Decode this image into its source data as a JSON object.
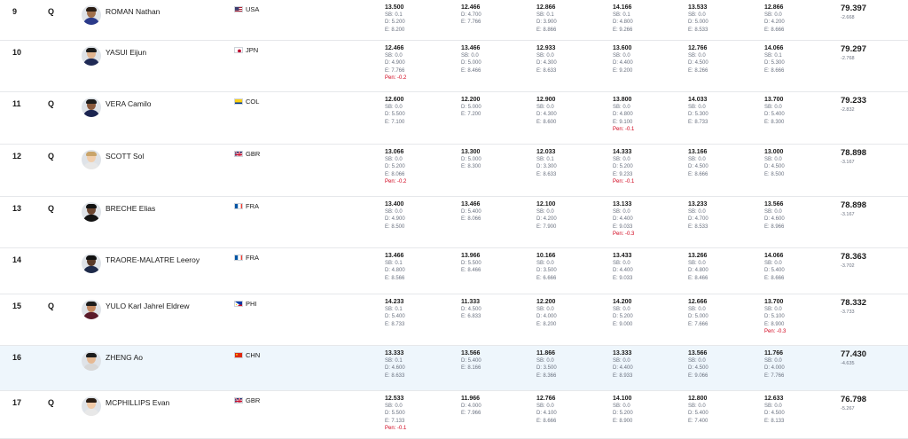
{
  "colors": {
    "highlight_bg": "#eef6fc",
    "penalty": "#d0021b",
    "divider": "#e6e8eb"
  },
  "rows": [
    {
      "rank": "9",
      "q": "Q",
      "name": "ROMAN Nathan",
      "country": "USA",
      "flag": "usa",
      "apps": [
        {
          "score": "13.500",
          "sb": "SB: 0.1",
          "d": "D: 5.200",
          "e": "E: 8.200",
          "pen": ""
        },
        {
          "score": "12.466",
          "sb": "D: 4.700",
          "d": "E: 7.766",
          "e": "",
          "pen": ""
        },
        {
          "score": "12.866",
          "sb": "SB: 0.1",
          "d": "D: 3.900",
          "e": "E: 8.866",
          "pen": ""
        },
        {
          "score": "14.166",
          "sb": "SB: 0.1",
          "d": "D: 4.800",
          "e": "E: 9.266",
          "pen": ""
        },
        {
          "score": "13.533",
          "sb": "SB: 0.0",
          "d": "D: 5.000",
          "e": "E: 8.533",
          "pen": ""
        },
        {
          "score": "12.866",
          "sb": "SB: 0.0",
          "d": "D: 4.200",
          "e": "E: 8.666",
          "pen": ""
        }
      ],
      "total": "79.397",
      "gap": "-2.668"
    },
    {
      "rank": "10",
      "q": "",
      "name": "YASUI Eijun",
      "country": "JPN",
      "flag": "jpn",
      "apps": [
        {
          "score": "12.466",
          "sb": "SB: 0.0",
          "d": "D: 4.900",
          "e": "E: 7.766",
          "pen": "Pen: -0.2"
        },
        {
          "score": "13.466",
          "sb": "SB: 0.0",
          "d": "D: 5.000",
          "e": "E: 8.466",
          "pen": ""
        },
        {
          "score": "12.933",
          "sb": "SB: 0.0",
          "d": "D: 4.300",
          "e": "E: 8.633",
          "pen": ""
        },
        {
          "score": "13.600",
          "sb": "SB: 0.0",
          "d": "D: 4.400",
          "e": "E: 9.200",
          "pen": ""
        },
        {
          "score": "12.766",
          "sb": "SB: 0.0",
          "d": "D: 4.500",
          "e": "E: 8.266",
          "pen": ""
        },
        {
          "score": "14.066",
          "sb": "SB: 0.1",
          "d": "D: 5.300",
          "e": "E: 8.666",
          "pen": ""
        }
      ],
      "total": "79.297",
      "gap": "-2.768"
    },
    {
      "rank": "11",
      "q": "Q",
      "name": "VERA Camilo",
      "country": "COL",
      "flag": "col",
      "apps": [
        {
          "score": "12.600",
          "sb": "SB: 0.0",
          "d": "D: 5.500",
          "e": "E: 7.100",
          "pen": ""
        },
        {
          "score": "12.200",
          "sb": "D: 5.000",
          "d": "E: 7.200",
          "e": "",
          "pen": ""
        },
        {
          "score": "12.900",
          "sb": "SB: 0.0",
          "d": "D: 4.300",
          "e": "E: 8.600",
          "pen": ""
        },
        {
          "score": "13.800",
          "sb": "SB: 0.0",
          "d": "D: 4.800",
          "e": "E: 9.100",
          "pen": "Pen: -0.1"
        },
        {
          "score": "14.033",
          "sb": "SB: 0.0",
          "d": "D: 5.300",
          "e": "E: 8.733",
          "pen": ""
        },
        {
          "score": "13.700",
          "sb": "SB: 0.0",
          "d": "D: 5.400",
          "e": "E: 8.300",
          "pen": ""
        }
      ],
      "total": "79.233",
      "gap": "-2.832"
    },
    {
      "rank": "12",
      "q": "Q",
      "name": "SCOTT Sol",
      "country": "GBR",
      "flag": "gbr",
      "apps": [
        {
          "score": "13.066",
          "sb": "SB: 0.0",
          "d": "D: 5.200",
          "e": "E: 8.066",
          "pen": "Pen: -0.2"
        },
        {
          "score": "13.300",
          "sb": "D: 5.000",
          "d": "E: 8.300",
          "e": "",
          "pen": ""
        },
        {
          "score": "12.033",
          "sb": "SB: 0.1",
          "d": "D: 3.300",
          "e": "E: 8.633",
          "pen": ""
        },
        {
          "score": "14.333",
          "sb": "SB: 0.0",
          "d": "D: 5.200",
          "e": "E: 9.233",
          "pen": "Pen: -0.1"
        },
        {
          "score": "13.166",
          "sb": "SB: 0.0",
          "d": "D: 4.500",
          "e": "E: 8.666",
          "pen": ""
        },
        {
          "score": "13.000",
          "sb": "SB: 0.0",
          "d": "D: 4.500",
          "e": "E: 8.500",
          "pen": ""
        }
      ],
      "total": "78.898",
      "gap": "-3.167"
    },
    {
      "rank": "13",
      "q": "Q",
      "name": "BRECHE Elias",
      "country": "FRA",
      "flag": "fra",
      "apps": [
        {
          "score": "13.400",
          "sb": "SB: 0.0",
          "d": "D: 4.900",
          "e": "E: 8.500",
          "pen": ""
        },
        {
          "score": "13.466",
          "sb": "D: 5.400",
          "d": "E: 8.066",
          "e": "",
          "pen": ""
        },
        {
          "score": "12.100",
          "sb": "SB: 0.0",
          "d": "D: 4.200",
          "e": "E: 7.900",
          "pen": ""
        },
        {
          "score": "13.133",
          "sb": "SB: 0.0",
          "d": "D: 4.400",
          "e": "E: 9.033",
          "pen": "Pen: -0.3"
        },
        {
          "score": "13.233",
          "sb": "SB: 0.0",
          "d": "D: 4.700",
          "e": "E: 8.533",
          "pen": ""
        },
        {
          "score": "13.566",
          "sb": "SB: 0.0",
          "d": "D: 4.600",
          "e": "E: 8.966",
          "pen": ""
        }
      ],
      "total": "78.898",
      "gap": "-3.167"
    },
    {
      "rank": "14",
      "q": "",
      "name": "TRAORE-MALATRE Leeroy",
      "country": "FRA",
      "flag": "fra",
      "apps": [
        {
          "score": "13.466",
          "sb": "SB: 0.1",
          "d": "D: 4.800",
          "e": "E: 8.566",
          "pen": ""
        },
        {
          "score": "13.966",
          "sb": "D: 5.500",
          "d": "E: 8.466",
          "e": "",
          "pen": ""
        },
        {
          "score": "10.166",
          "sb": "SB: 0.0",
          "d": "D: 3.500",
          "e": "E: 6.666",
          "pen": ""
        },
        {
          "score": "13.433",
          "sb": "SB: 0.0",
          "d": "D: 4.400",
          "e": "E: 9.033",
          "pen": ""
        },
        {
          "score": "13.266",
          "sb": "SB: 0.0",
          "d": "D: 4.800",
          "e": "E: 8.466",
          "pen": ""
        },
        {
          "score": "14.066",
          "sb": "SB: 0.0",
          "d": "D: 5.400",
          "e": "E: 8.666",
          "pen": ""
        }
      ],
      "total": "78.363",
      "gap": "-3.702"
    },
    {
      "rank": "15",
      "q": "Q",
      "name": "YULO Karl Jahrel Eldrew",
      "country": "PHI",
      "flag": "phi",
      "apps": [
        {
          "score": "14.233",
          "sb": "SB: 0.1",
          "d": "D: 5.400",
          "e": "E: 8.733",
          "pen": ""
        },
        {
          "score": "11.333",
          "sb": "D: 4.500",
          "d": "E: 6.833",
          "e": "",
          "pen": ""
        },
        {
          "score": "12.200",
          "sb": "SB: 0.0",
          "d": "D: 4.000",
          "e": "E: 8.200",
          "pen": ""
        },
        {
          "score": "14.200",
          "sb": "SB: 0.0",
          "d": "D: 5.200",
          "e": "E: 9.000",
          "pen": ""
        },
        {
          "score": "12.666",
          "sb": "SB: 0.0",
          "d": "D: 5.000",
          "e": "E: 7.666",
          "pen": ""
        },
        {
          "score": "13.700",
          "sb": "SB: 0.0",
          "d": "D: 5.100",
          "e": "E: 8.900",
          "pen": "Pen: -0.3"
        }
      ],
      "total": "78.332",
      "gap": "-3.733"
    },
    {
      "rank": "16",
      "q": "",
      "name": "ZHENG Ao",
      "country": "CHN",
      "flag": "chn",
      "highlight": true,
      "apps": [
        {
          "score": "13.333",
          "sb": "SB: 0.1",
          "d": "D: 4.600",
          "e": "E: 8.633",
          "pen": ""
        },
        {
          "score": "13.566",
          "sb": "D: 5.400",
          "d": "E: 8.166",
          "e": "",
          "pen": ""
        },
        {
          "score": "11.866",
          "sb": "SB: 0.0",
          "d": "D: 3.500",
          "e": "E: 8.366",
          "pen": ""
        },
        {
          "score": "13.333",
          "sb": "SB: 0.0",
          "d": "D: 4.400",
          "e": "E: 8.933",
          "pen": ""
        },
        {
          "score": "13.566",
          "sb": "SB: 0.0",
          "d": "D: 4.500",
          "e": "E: 9.066",
          "pen": ""
        },
        {
          "score": "11.766",
          "sb": "SB: 0.0",
          "d": "D: 4.000",
          "e": "E: 7.766",
          "pen": ""
        }
      ],
      "total": "77.430",
      "gap": "-4.635"
    },
    {
      "rank": "17",
      "q": "Q",
      "name": "MCPHILLIPS Evan",
      "country": "GBR",
      "flag": "gbr",
      "apps": [
        {
          "score": "12.533",
          "sb": "SB: 0.0",
          "d": "D: 5.500",
          "e": "E: 7.133",
          "pen": "Pen: -0.1"
        },
        {
          "score": "11.966",
          "sb": "D: 4.000",
          "d": "E: 7.966",
          "e": "",
          "pen": ""
        },
        {
          "score": "12.766",
          "sb": "SB: 0.0",
          "d": "D: 4.100",
          "e": "E: 8.666",
          "pen": ""
        },
        {
          "score": "14.100",
          "sb": "SB: 0.0",
          "d": "D: 5.200",
          "e": "E: 8.900",
          "pen": ""
        },
        {
          "score": "12.800",
          "sb": "SB: 0.0",
          "d": "D: 5.400",
          "e": "E: 7.400",
          "pen": ""
        },
        {
          "score": "12.633",
          "sb": "SB: 0.0",
          "d": "D: 4.500",
          "e": "E: 8.133",
          "pen": ""
        }
      ],
      "total": "76.798",
      "gap": "-5.267"
    }
  ]
}
